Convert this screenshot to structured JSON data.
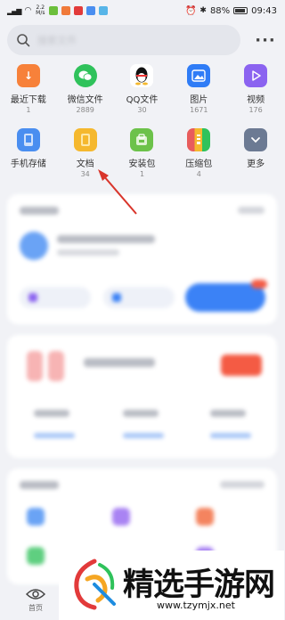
{
  "status_bar": {
    "speed": "2.2 M/s",
    "battery": "88%",
    "time": "09:43"
  },
  "search": {
    "placeholder": "搜索文件",
    "more_icon": "more-dots-icon"
  },
  "categories": [
    {
      "label": "最近下载",
      "count": "1",
      "icon": "download-icon",
      "color": "#f7813a"
    },
    {
      "label": "微信文件",
      "count": "2889",
      "icon": "wechat-icon",
      "color": "#2fc25b"
    },
    {
      "label": "QQ文件",
      "count": "30",
      "icon": "qq-penguin-icon",
      "color": "#ffffff"
    },
    {
      "label": "图片",
      "count": "1671",
      "icon": "image-icon",
      "color": "#2f7cf6"
    },
    {
      "label": "视频",
      "count": "176",
      "icon": "play-icon",
      "color": "#8b63f0"
    },
    {
      "label": "手机存储",
      "count": "",
      "icon": "phone-storage-icon",
      "color": "#4a8ef0"
    },
    {
      "label": "文档",
      "count": "34",
      "icon": "document-icon",
      "color": "#f5b82e"
    },
    {
      "label": "安装包",
      "count": "1",
      "icon": "package-icon",
      "color": "#6cc24a"
    },
    {
      "label": "压缩包",
      "count": "4",
      "icon": "archive-icon",
      "color": "#e85c5c"
    },
    {
      "label": "更多",
      "count": "",
      "icon": "more-chevron-icon",
      "color": "#6c7a93"
    }
  ],
  "nav": {
    "home_label": "首页"
  },
  "watermark": {
    "text": "精选手游网",
    "url": "www.tzymjx.net"
  },
  "colors": {
    "accent_blue": "#3b82f6",
    "badge_red": "#f45b44",
    "background": "#f1f2f6"
  }
}
